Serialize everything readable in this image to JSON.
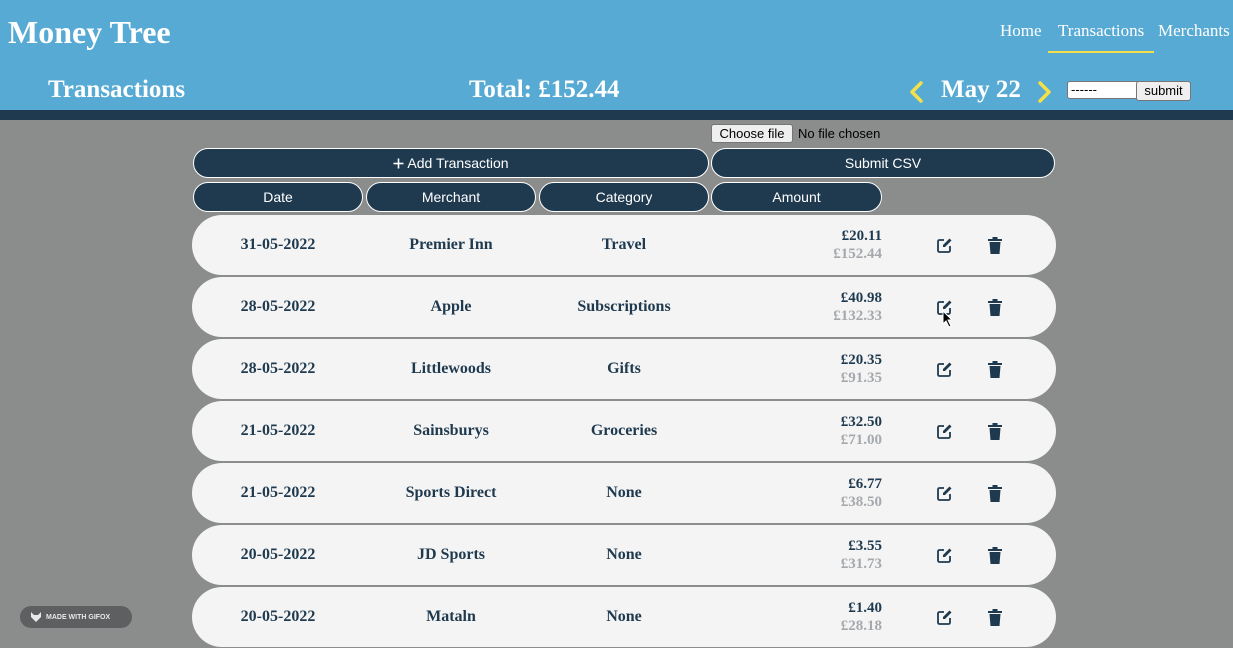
{
  "app": {
    "title": "Money Tree"
  },
  "nav": {
    "items": [
      {
        "label": "Home"
      },
      {
        "label": "Transactions",
        "active": true
      },
      {
        "label": "Merchants"
      }
    ]
  },
  "subheader": {
    "title": "Transactions",
    "total": "Total: £152.44",
    "month": "May 22",
    "date_placeholder": "------",
    "submit_label": "submit"
  },
  "upload": {
    "choose_label": "Choose file",
    "status": "No file chosen"
  },
  "actions": {
    "add_label": "Add Transaction",
    "csv_label": "Submit CSV"
  },
  "columns": [
    "Date",
    "Merchant",
    "Category",
    "Amount"
  ],
  "transactions": [
    {
      "date": "31-05-2022",
      "merchant": "Premier Inn",
      "category": "Travel",
      "amount": "£20.11",
      "running": "£152.44"
    },
    {
      "date": "28-05-2022",
      "merchant": "Apple",
      "category": "Subscriptions",
      "amount": "£40.98",
      "running": "£132.33"
    },
    {
      "date": "28-05-2022",
      "merchant": "Littlewoods",
      "category": "Gifts",
      "amount": "£20.35",
      "running": "£91.35"
    },
    {
      "date": "21-05-2022",
      "merchant": "Sainsburys",
      "category": "Groceries",
      "amount": "£32.50",
      "running": "£71.00"
    },
    {
      "date": "21-05-2022",
      "merchant": "Sports Direct",
      "category": "None",
      "amount": "£6.77",
      "running": "£38.50"
    },
    {
      "date": "20-05-2022",
      "merchant": "JD Sports",
      "category": "None",
      "amount": "£3.55",
      "running": "£31.73"
    },
    {
      "date": "20-05-2022",
      "merchant": "Mataln",
      "category": "None",
      "amount": "£1.40",
      "running": "£28.18"
    }
  ],
  "watermark": {
    "text": "MADE WITH GIFOX"
  },
  "colors": {
    "header": "#57aad3",
    "dark": "#1f3a4f",
    "background": "#8b8c8c",
    "accent": "#f4e04a",
    "row": "#f4f4f4",
    "muted": "#a5a9ad"
  },
  "icons": {
    "prev": "chevron-left-icon",
    "next": "chevron-right-icon",
    "add": "plus-icon",
    "edit": "edit-icon",
    "delete": "trash-icon",
    "calendar": "calendar-icon"
  }
}
